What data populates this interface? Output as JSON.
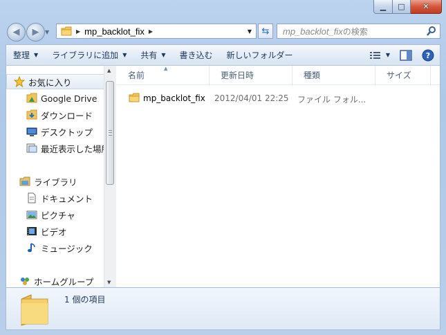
{
  "window": {
    "caption_buttons": {
      "minimize_icon": "minimize-icon",
      "maximize_icon": "maximize-icon",
      "close_icon": "close-icon"
    }
  },
  "address": {
    "path": "mp_backlot_fix"
  },
  "search": {
    "placeholder_italic": "mp_backlot_fix",
    "placeholder_suffix": "の検索"
  },
  "toolbar": {
    "organize": "整理",
    "add_to_library": "ライブラリに追加",
    "share": "共有",
    "burn": "書き込む",
    "new_folder": "新しいフォルダー"
  },
  "sidebar": {
    "favorites": "お気に入り",
    "items_fav": [
      "Google Drive",
      "ダウンロード",
      "デスクトップ",
      "最近表示した場所"
    ],
    "libraries": "ライブラリ",
    "items_lib": [
      "ドキュメント",
      "ピクチャ",
      "ビデオ",
      "ミュージック"
    ],
    "homegroup": "ホームグループ"
  },
  "columns": [
    "名前",
    "更新日時",
    "種類",
    "サイズ"
  ],
  "files": [
    {
      "name": "mp_backlot_fix",
      "modified": "2012/04/01 22:25",
      "type": "ファイル フォル...",
      "size": ""
    }
  ],
  "status": {
    "count_text": "1 個の項目"
  },
  "colors": {
    "accent": "#1e395b",
    "frame": "#b9cfea",
    "selection": "#e3ebf5"
  }
}
